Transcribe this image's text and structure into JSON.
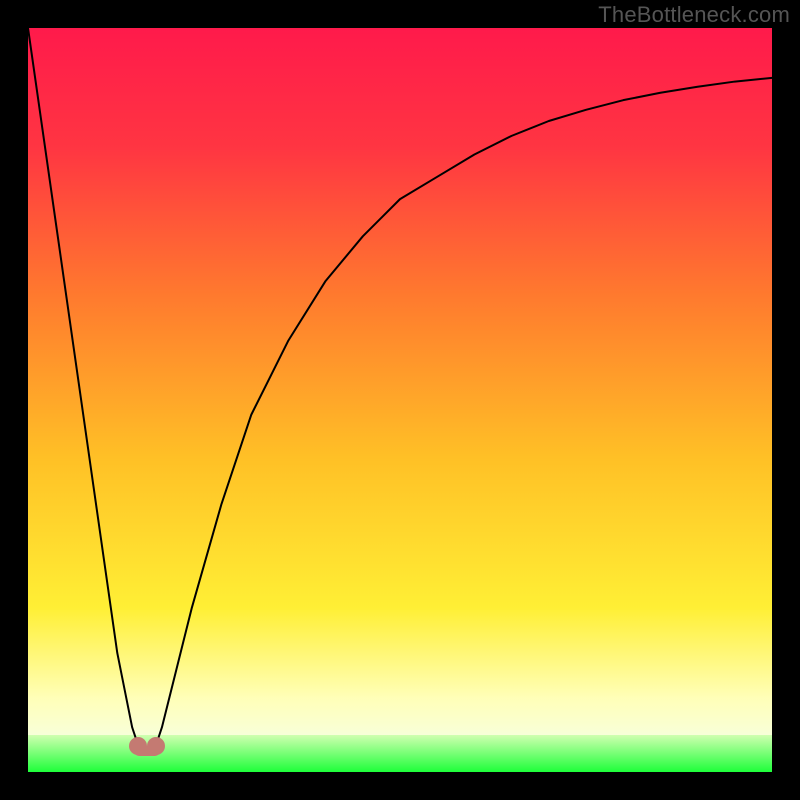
{
  "attribution": "TheBottleneck.com",
  "colors": {
    "frame": "#000000",
    "grad_top": "#ff1a4b",
    "grad_upper_mid": "#ff5a33",
    "grad_mid": "#ffb224",
    "grad_lower_mid": "#ffe838",
    "grad_pale_band": "#ffffc0",
    "grad_green": "#1eff3a",
    "curve": "#000000",
    "marker": "#c47a72"
  },
  "chart_data": {
    "type": "line",
    "title": "",
    "xlabel": "",
    "ylabel": "",
    "xlim": [
      0,
      100
    ],
    "ylim": [
      0,
      100
    ],
    "grid": false,
    "series": [
      {
        "name": "bottleneck-curve",
        "x": [
          0,
          4,
          8,
          12,
          14,
          15,
          16,
          17,
          18,
          20,
          22,
          26,
          30,
          35,
          40,
          45,
          50,
          55,
          60,
          65,
          70,
          75,
          80,
          85,
          90,
          95,
          100
        ],
        "values": [
          100,
          72,
          44,
          16,
          6,
          3,
          3,
          3,
          6,
          14,
          22,
          36,
          48,
          58,
          66,
          72,
          77,
          80,
          83,
          85.5,
          87.5,
          89,
          90.3,
          91.3,
          92.1,
          92.8,
          93.3
        ]
      }
    ],
    "marker": {
      "x": 16,
      "y": 3,
      "label": ""
    },
    "annotations": []
  }
}
